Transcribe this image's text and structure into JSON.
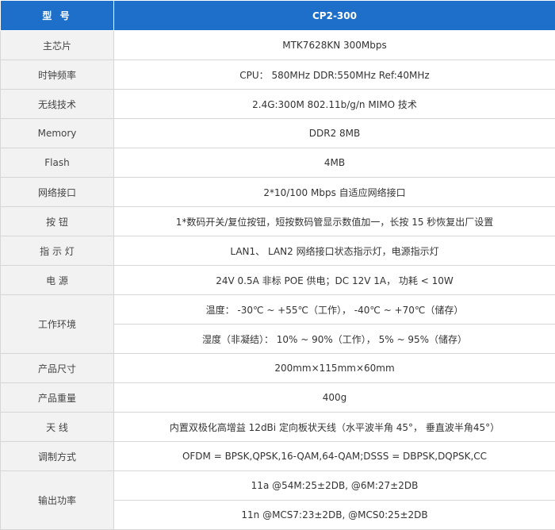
{
  "header": {
    "label": "型 号",
    "model": "CP2-300"
  },
  "rows": [
    {
      "label": "主芯片",
      "values": [
        "MTK7628KN 300Mbps"
      ]
    },
    {
      "label": "时钟频率",
      "values": [
        "CPU： 580MHz DDR:550MHz Ref:40MHz"
      ]
    },
    {
      "label": "无线技术",
      "values": [
        "2.4G:300M 802.11b/g/n MIMO 技术"
      ]
    },
    {
      "label": "Memory",
      "values": [
        "DDR2 8MB"
      ]
    },
    {
      "label": "Flash",
      "values": [
        "4MB"
      ]
    },
    {
      "label": "网络接口",
      "values": [
        "2*10/100 Mbps 自适应网络接口"
      ]
    },
    {
      "label": "按 钮",
      "values": [
        "1*数码开关/复位按钮，短按数码管显示数值加一，长按 15 秒恢复出厂设置"
      ]
    },
    {
      "label": "指 示 灯",
      "values": [
        "LAN1、 LAN2 网络接口状态指示灯，电源指示灯"
      ]
    },
    {
      "label": "电 源",
      "values": [
        "24V 0.5A 非标 POE 供电；DC 12V 1A， 功耗 < 10W"
      ]
    },
    {
      "label": "工作环境",
      "values": [
        "温度： -30℃ ~ +55℃（工作）， -40℃ ~ +70℃（储存）",
        "湿度（非凝结）： 10% ~ 90%（工作）， 5% ~ 95%（储存）"
      ]
    },
    {
      "label": "产品尺寸",
      "values": [
        "200mm×115mm×60mm"
      ]
    },
    {
      "label": "产品重量",
      "values": [
        "400g"
      ]
    },
    {
      "label": "天 线",
      "values": [
        "内置双极化高增益 12dBi 定向板状天线（水平波半角 45°， 垂直波半角45°）"
      ]
    },
    {
      "label": "调制方式",
      "values": [
        "OFDM = BPSK,QPSK,16-QAM,64-QAM;DSSS = DBPSK,DQPSK,CC"
      ]
    },
    {
      "label": "输出功率",
      "values": [
        "11a @54M:25±2DB, @6M:27±2DB",
        "11n @MCS7:23±2DB, @MCS0:25±2DB"
      ]
    }
  ]
}
